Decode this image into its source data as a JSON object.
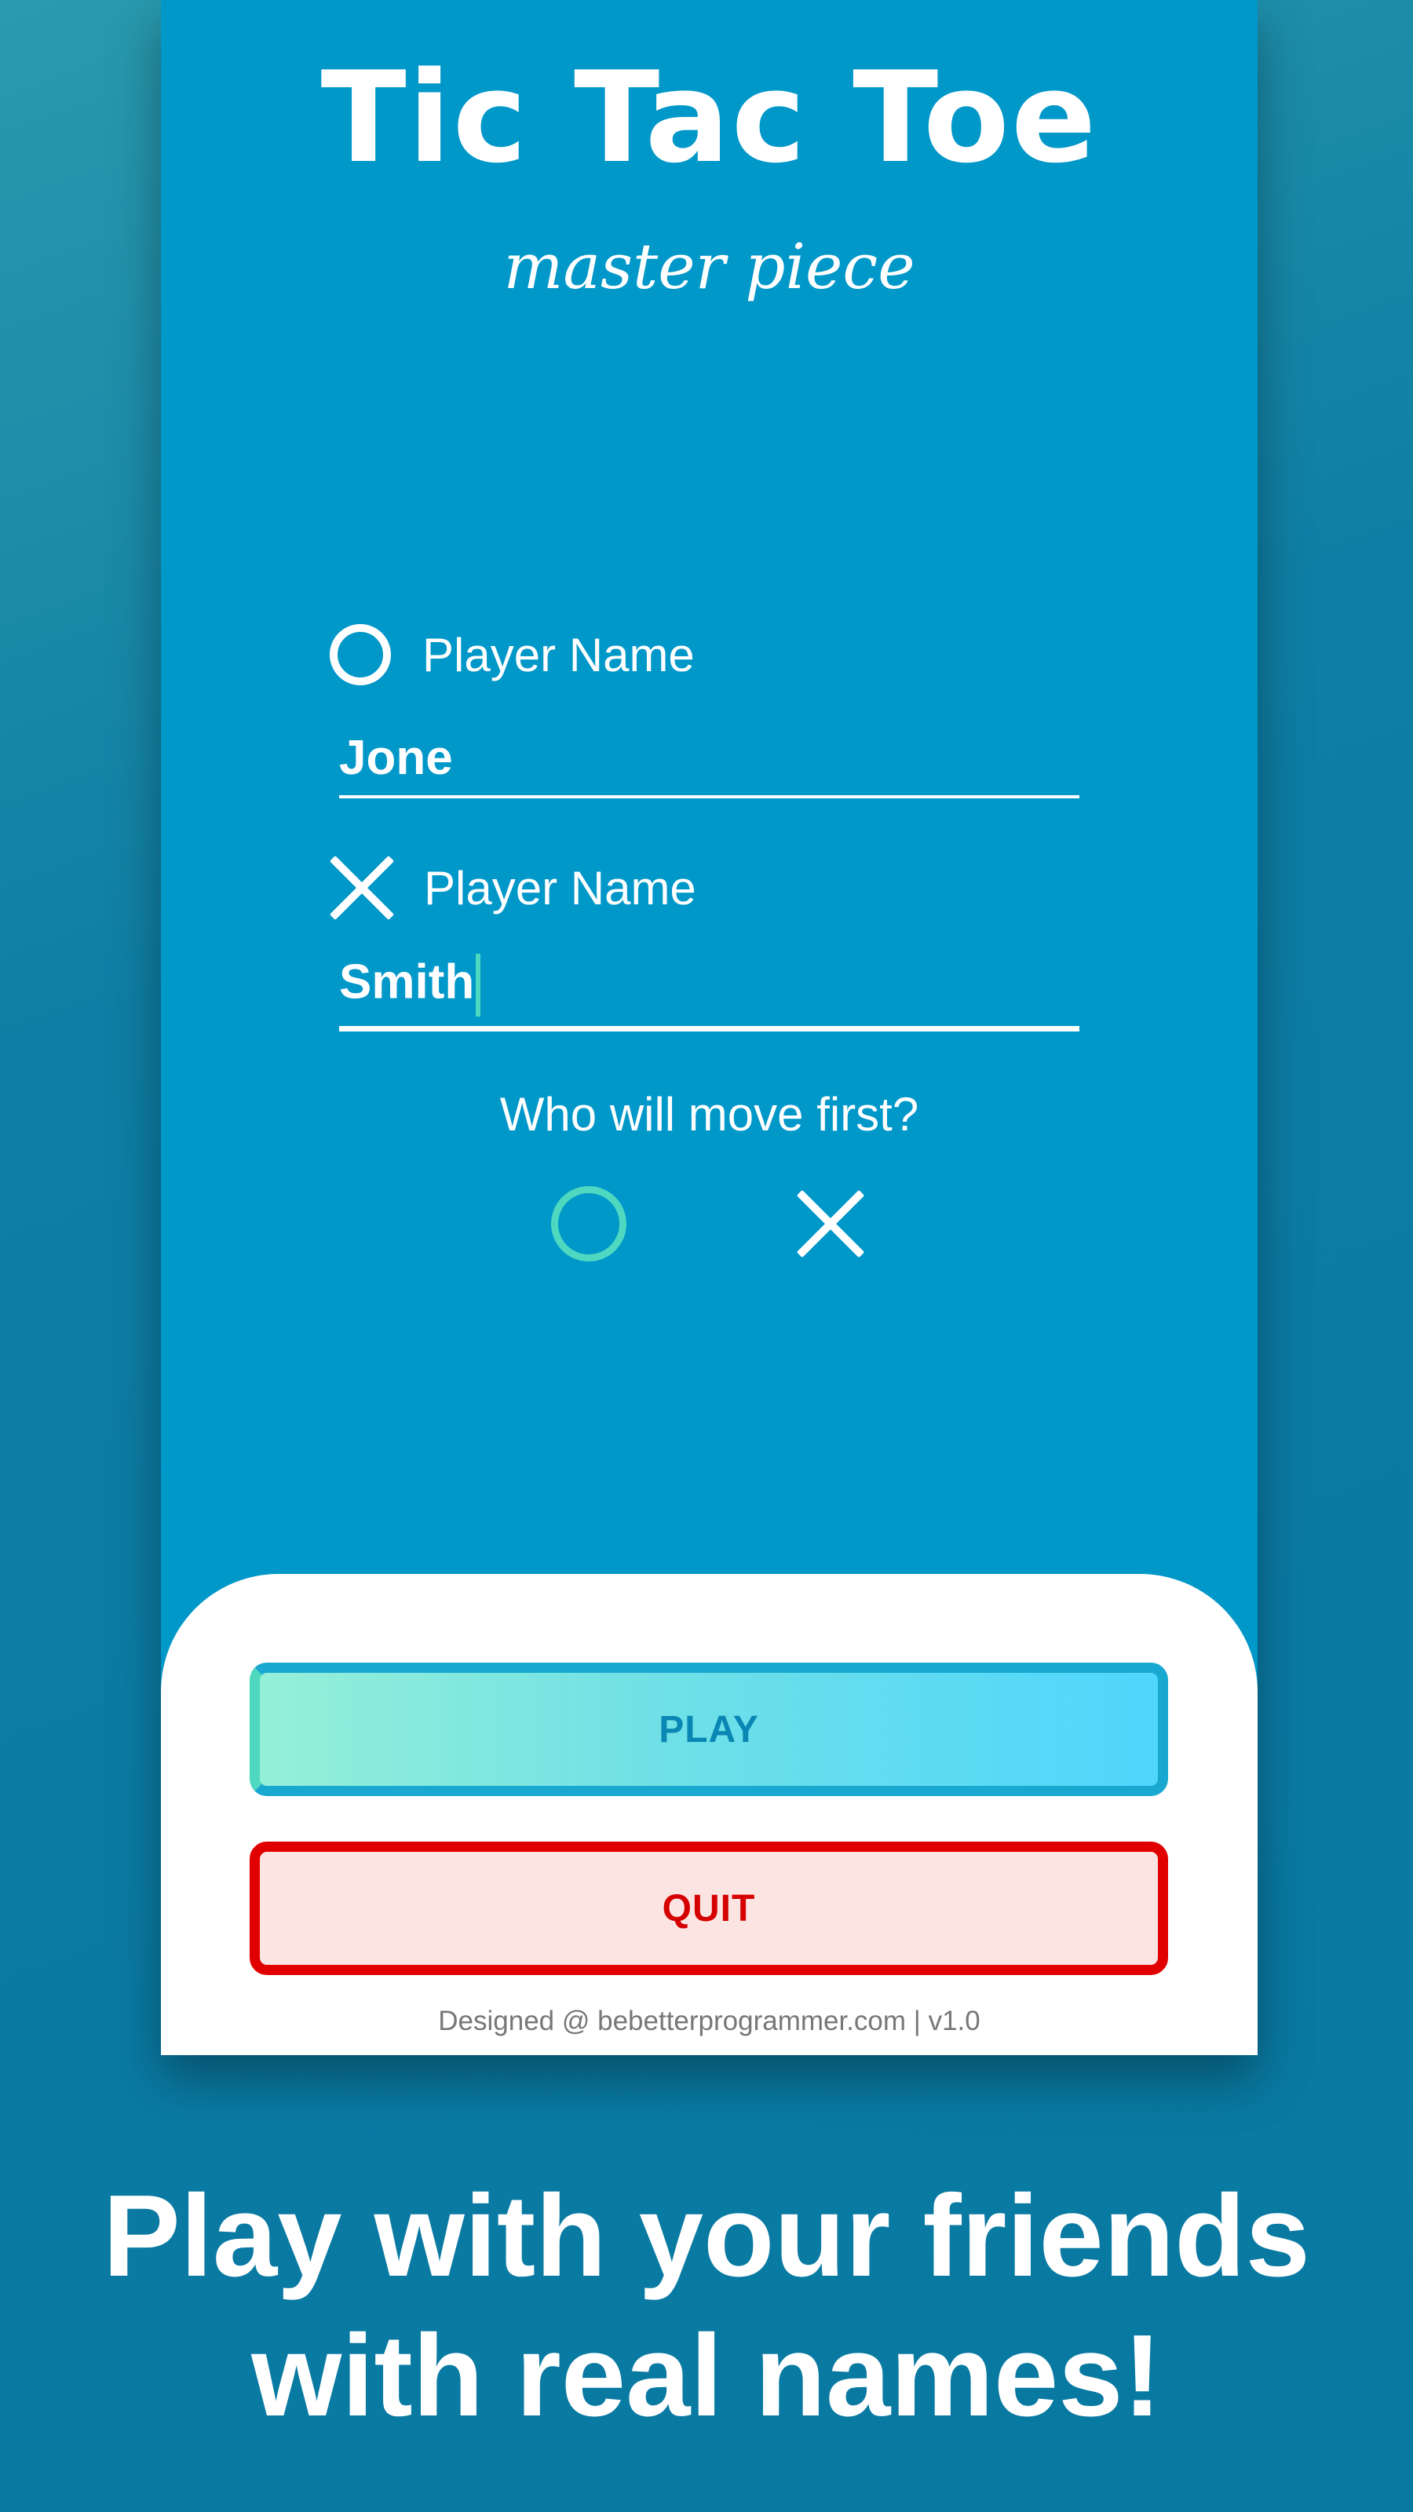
{
  "app": {
    "title": "Tic Tac Toe",
    "subtitle": "master piece"
  },
  "player_o": {
    "icon": "circle-o-icon",
    "label": "Player Name",
    "value": "Jone"
  },
  "player_x": {
    "icon": "cross-x-icon",
    "label": "Player Name",
    "value": "Smith"
  },
  "first_move": {
    "question": "Who will move first?",
    "selected": "O",
    "options": [
      {
        "symbol": "O",
        "icon": "circle-o-icon"
      },
      {
        "symbol": "X",
        "icon": "cross-x-icon"
      }
    ]
  },
  "buttons": {
    "play": "PLAY",
    "quit": "QUIT"
  },
  "footer": {
    "credit": "Designed @ bebetterprogrammer.com | v1.0"
  },
  "promo": {
    "line1": "Play with your friends",
    "line2": "with real names!"
  },
  "colors": {
    "screen_bg": "#0097c9",
    "accent_teal": "#4fd8c0",
    "play_text": "#0a86b4",
    "quit_border": "#e00000",
    "quit_bg": "#fbe4e2"
  }
}
